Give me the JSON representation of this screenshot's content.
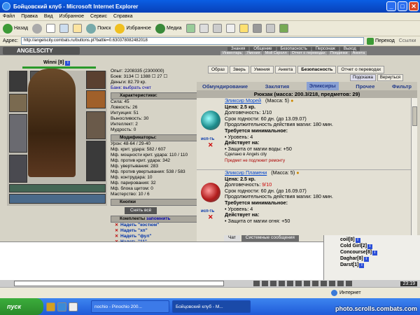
{
  "window": {
    "title": "Бойцовский клуб - Microsoft Internet Explorer"
  },
  "menu": [
    "Файл",
    "Правка",
    "Вид",
    "Избранное",
    "Сервис",
    "Справка"
  ],
  "toolbar": {
    "back": "Назад",
    "search": "Поиск",
    "favorites": "Избранное",
    "media": "Медиа"
  },
  "address": {
    "label": "Адрес:",
    "url": "http://angelscity.combats.ru/buttons.pl?battle=0.630378082482018",
    "go": "Переход",
    "links": "Ссылки"
  },
  "game": {
    "logo": "ANGELSCITY",
    "nav1": [
      "Знания",
      "Общение",
      "Безопасность",
      "Персонаж",
      "Выход"
    ],
    "nav2": [
      "Инвентарь",
      "Умения",
      "Мой Скролл",
      "Отчет о переводах",
      "Поединки",
      "Анкета"
    ]
  },
  "character": {
    "name": "Winni",
    "level": "[8]",
    "icon": "i",
    "stats": {
      "exp": "Опыт: 2208335 (2300000)",
      "battles": "Боев: 3134 ☐ 1388 ☐ 27 ☐",
      "money": "Деньги: 82.79 кр.",
      "bank": "Банк: выбрать счет"
    },
    "char_hdr": "Характеристики:",
    "attrs": [
      "Сила: 45",
      "Ловкость: 26",
      "Интуиция: 51",
      "Выносливость: 30",
      "Интеллект: 2",
      "Мудрость: 0"
    ],
    "mods_hdr": "Модификаторы:",
    "mods": [
      "Урон: 48-64 / 29-40",
      "Мф. крит. удара: 582 / 607",
      "Мф. мощности крит. удара: 110 / 110",
      "Мф. против крит. удара: 342",
      "Мф. увертывания: 283",
      "Мф. против увертывания: 538 / 583",
      "Мф. контрудара: 10",
      "Мф. парирования: 32",
      "Мф. блока щитом: 0",
      "Мастерство: 10 / 6"
    ],
    "buttons_hdr": "Кнопки",
    "remove_all": "Снять всё",
    "sets_hdr": "Комплекты",
    "sets_remember": "запомнить",
    "sets": [
      "Надеть \"костюм\"",
      "Надеть \"хп\"",
      "Надеть \"фул\"",
      "Надеть \"11\""
    ]
  },
  "top_buttons": [
    "Образ",
    "Зверь",
    "Умения",
    "Анкета",
    "Безопасность",
    "Отчет о переводах"
  ],
  "top_buttons2": [
    "Подсказка",
    "Вернуться"
  ],
  "shop_tabs": [
    "Обмундирование",
    "Заклятия",
    "Эликсиры",
    "Прочее",
    "Фильтр"
  ],
  "backpack": "Рюкзак (масса: 200.3/218, предметов: 29)",
  "items": [
    {
      "name": "Эликсир Морей",
      "mass": "(Масса: 5)",
      "price": "Цена: 2.5 кр.",
      "durability_label": "Долговечность: ",
      "durability": "1/10",
      "expiry": "Срок годности: 60 дн. (до 13.09.07)",
      "duration": "Продолжительность действия магии: 180 мин.",
      "req_hdr": "Требуется минимальное:",
      "req": "• Уровень: 4",
      "act_hdr": "Действует на:",
      "effect": "• Защита от магии воды: +50",
      "made": "Сделано в Angels city",
      "note": "Предмет не подлежит ремонту",
      "use": "исп-ть",
      "color": "#2aa7a7"
    },
    {
      "name": "Эликсир Пламени",
      "mass": "(Масса: 5)",
      "price": "Цена: 2.5 кр.",
      "durability_label": "Долговечность: ",
      "durability": "9/10",
      "expiry": "Срок годности: 60 дн. (до 16.09.07)",
      "duration": "Продолжительность действия магии: 180 мин.",
      "req_hdr": "Требуется минимальное:",
      "req": "• Уровень: 4",
      "act_hdr": "Действует на:",
      "effect": "• Защита от магии огня: +50",
      "use": "исп-ть",
      "color": "#c83a2a"
    }
  ],
  "chat": {
    "tab_chat": "Чат",
    "tab_system": "Системные сообщения"
  },
  "online": [
    {
      "name": "coil",
      "lvl": "[8]"
    },
    {
      "name": "Cold Girl",
      "lvl": "[2]"
    },
    {
      "name": "Concourse",
      "lvl": "[8]"
    },
    {
      "name": "Daghar",
      "lvl": "[8]"
    },
    {
      "name": "Darst",
      "lvl": "[1]"
    }
  ],
  "clock": "23:19",
  "status": {
    "left": "",
    "zone": "Интернет"
  },
  "taskbar": {
    "start": "пуск",
    "tasks": [
      "nochio - Pinochio 200...",
      "Бойцовский клуб - M..."
    ]
  },
  "watermark": "photo.scrolls.combats.com"
}
